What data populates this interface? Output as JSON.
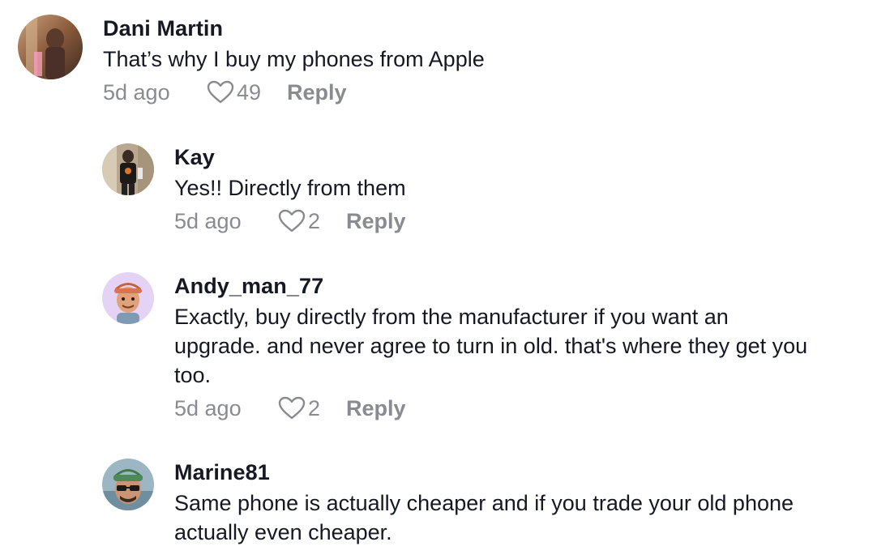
{
  "comments": [
    {
      "username": "Dani Martin",
      "text": "That’s why I buy my phones from Apple",
      "time": "5d ago",
      "likes": "49",
      "reply_label": "Reply",
      "icon": "heart-outline-icon"
    },
    {
      "username": "Kay",
      "text": "Yes!! Directly from them",
      "time": "5d ago",
      "likes": "2",
      "reply_label": "Reply",
      "icon": "heart-outline-icon"
    },
    {
      "username": "Andy_man_77",
      "text_lines": [
        "Exactly, buy directly from the manufacturer if you want an",
        "upgrade. and never agree to turn in old. that's where they get you",
        "too."
      ],
      "time": "5d ago",
      "likes": "2",
      "reply_label": "Reply",
      "icon": "heart-outline-icon"
    },
    {
      "username": "Marine81",
      "text_lines": [
        "Same phone is actually cheaper and if you trade your old phone",
        "actually even cheaper."
      ]
    }
  ],
  "colors": {
    "primary_text": "#161823",
    "secondary_text": "#8a8b91"
  }
}
